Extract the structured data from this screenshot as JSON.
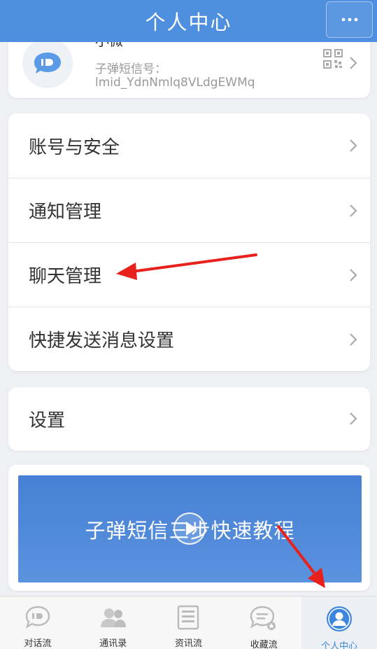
{
  "header": {
    "title": "个人中心"
  },
  "profile": {
    "name": "小微",
    "id_label": "子弹短信号：",
    "id_value": "lmid_YdnNmlq8VLdgEWMq"
  },
  "menu": {
    "items": [
      {
        "label": "账号与安全"
      },
      {
        "label": "通知管理"
      },
      {
        "label": "聊天管理"
      },
      {
        "label": "快捷发送消息设置"
      }
    ]
  },
  "settings": {
    "label": "设置"
  },
  "tutorial": {
    "banner_text": "子弹短信三步快速教程"
  },
  "bottom_nav": {
    "items": [
      {
        "label": "对话流",
        "icon": "chat-bubble-icon"
      },
      {
        "label": "通讯录",
        "icon": "contacts-icon"
      },
      {
        "label": "资讯流",
        "icon": "news-icon"
      },
      {
        "label": "收藏流",
        "icon": "favorites-icon"
      },
      {
        "label": "个人中心",
        "icon": "profile-icon"
      }
    ],
    "active_index": 4
  },
  "colors": {
    "header": "#4f8fe0",
    "accent": "#3d86e0",
    "annotation": "#e8211c"
  }
}
